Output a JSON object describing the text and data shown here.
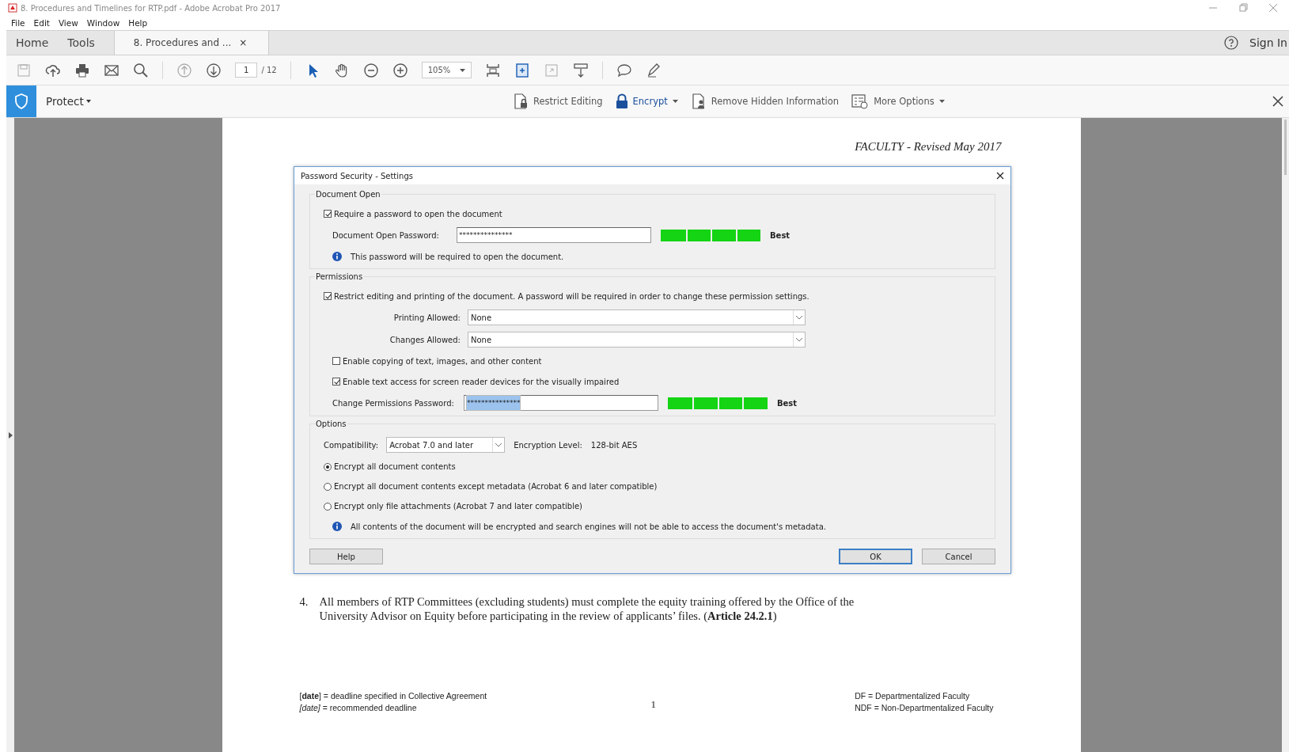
{
  "window": {
    "title": "8. Procedures and Timelines for RTP.pdf - Adobe Acrobat Pro 2017"
  },
  "menu": [
    "File",
    "Edit",
    "View",
    "Window",
    "Help"
  ],
  "nav_tabs": [
    {
      "label": "Home",
      "selected": false
    },
    {
      "label": "Tools",
      "selected": false
    }
  ],
  "doc_tabs": [
    {
      "label": "8. Procedures and ...",
      "selected": true,
      "close": "×"
    }
  ],
  "sign_in": "Sign In",
  "toolbar": {
    "page": "1",
    "page_count": "/ 12",
    "zoom": "105%"
  },
  "protect_bar": {
    "title": "Protect",
    "actions": [
      {
        "label": "Restrict Editing",
        "kind": "restrict",
        "dropdown": false
      },
      {
        "label": "Encrypt",
        "kind": "encrypt",
        "dropdown": true
      },
      {
        "label": "Remove Hidden Information",
        "kind": "remove",
        "dropdown": false
      },
      {
        "label": "More Options",
        "kind": "more",
        "dropdown": true
      }
    ]
  },
  "document": {
    "header": "FACULTY  - Revised May 2017",
    "item_number": "4.",
    "item_text": "All members of RTP Committees (excluding students) must complete the equity training offered by the Office of the University Advisor on Equity before participating in the review of applicants’ files.  (**Article 24.2.1**)",
    "footer_left": [
      "[**date**] = deadline specified in Collective Agreement",
      "*[date]* = recommended deadline"
    ],
    "page_number": "1",
    "footer_right": [
      "DF = Departmentalized Faculty",
      "NDF = Non-Departmentalized Faculty"
    ]
  },
  "dialog": {
    "title": "Password Security - Settings",
    "document_open": {
      "legend": "Document Open",
      "require": {
        "label": "Require a password to open the document",
        "checked": true
      },
      "password": {
        "label": "Document Open Password:",
        "value": "***************",
        "selected": false,
        "level": 1,
        "rating": "Best"
      },
      "info": "This password will be required to open the document."
    },
    "permissions": {
      "legend": "Permissions",
      "restrict": {
        "label": "Restrict editing and printing of the document. A password will be required in order to change these permission settings.",
        "checked": true
      },
      "selects": [
        {
          "label": "Printing Allowed:",
          "value": "None"
        },
        {
          "label": "Changes Allowed:",
          "value": "None"
        }
      ],
      "checks": [
        {
          "label": "Enable copying of text, images, and other content",
          "checked": false
        },
        {
          "label": "Enable text access for screen reader devices for the visually impaired",
          "checked": true
        }
      ],
      "password": {
        "label": "Change Permissions Password:",
        "value": "***************",
        "selected": true,
        "level": 1,
        "rating": "Best"
      }
    },
    "options": {
      "legend": "Options",
      "compatibility": {
        "label": "Compatibility:",
        "value": "Acrobat 7.0 and later"
      },
      "encryption_label": "Encryption  Level:",
      "encryption_value": "128-bit AES",
      "radios": [
        {
          "label": "Encrypt all document contents",
          "selected": true
        },
        {
          "label": "Encrypt all document contents except metadata (Acrobat 6 and later compatible)",
          "selected": false
        },
        {
          "label": "Encrypt only file attachments (Acrobat 7 and later compatible)",
          "selected": false
        }
      ],
      "info": "All contents of the document will be encrypted and search engines will not be able to access the document's metadata."
    },
    "buttons": [
      {
        "label": "Help",
        "default": false
      },
      {
        "label": "OK",
        "default": true
      },
      {
        "label": "Cancel",
        "default": false
      }
    ]
  }
}
